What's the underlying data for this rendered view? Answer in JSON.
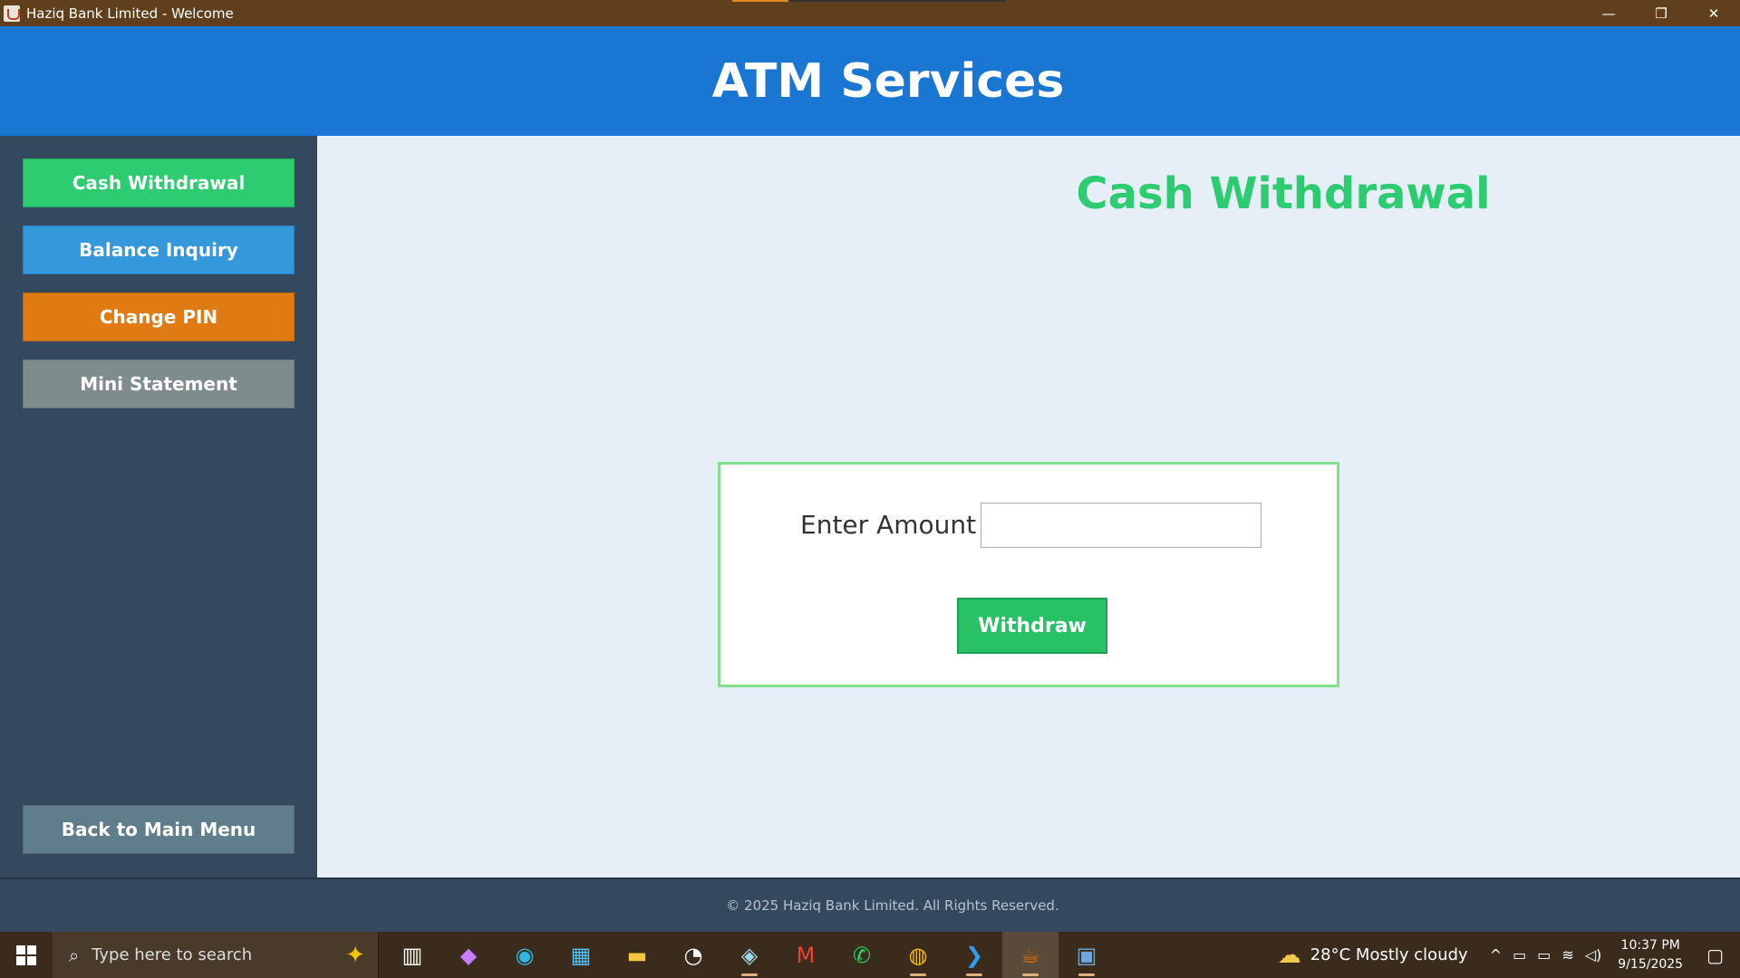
{
  "window": {
    "title": "Haziq Bank Limited - Welcome",
    "minimize": "—",
    "restore": "❐",
    "close": "✕"
  },
  "header": {
    "title": "ATM Services"
  },
  "sidebar": {
    "items": [
      {
        "label": "Cash Withdrawal",
        "color": "#2ecc71"
      },
      {
        "label": "Balance Inquiry",
        "color": "#3498db"
      },
      {
        "label": "Change PIN",
        "color": "#e07a12"
      },
      {
        "label": "Mini Statement",
        "color": "#7f8c8d"
      }
    ],
    "back_label": "Back to Main Menu"
  },
  "main": {
    "title": "Cash Withdrawal",
    "amount_label": "Enter Amount",
    "amount_value": "",
    "withdraw_label": "Withdraw"
  },
  "footer": {
    "text": "© 2025 Haziq Bank Limited. All Rights Reserved."
  },
  "taskbar": {
    "search_placeholder": "Type here to search",
    "weather": "28°C  Mostly cloudy",
    "time": "10:37 PM",
    "date": "9/15/2025",
    "apps": [
      "task-view-icon",
      "copilot-icon",
      "edge-icon",
      "store-icon",
      "file-explorer-icon",
      "speedometer-icon",
      "notes-icon",
      "gmail-icon",
      "whatsapp-icon",
      "chrome-icon",
      "vscode-icon",
      "java-icon",
      "mysql-workbench-icon"
    ]
  },
  "colors": {
    "header": "#1976d2",
    "sidebar": "#34495e",
    "accent_green": "#2ecc71",
    "main_bg": "#e6eef8"
  }
}
